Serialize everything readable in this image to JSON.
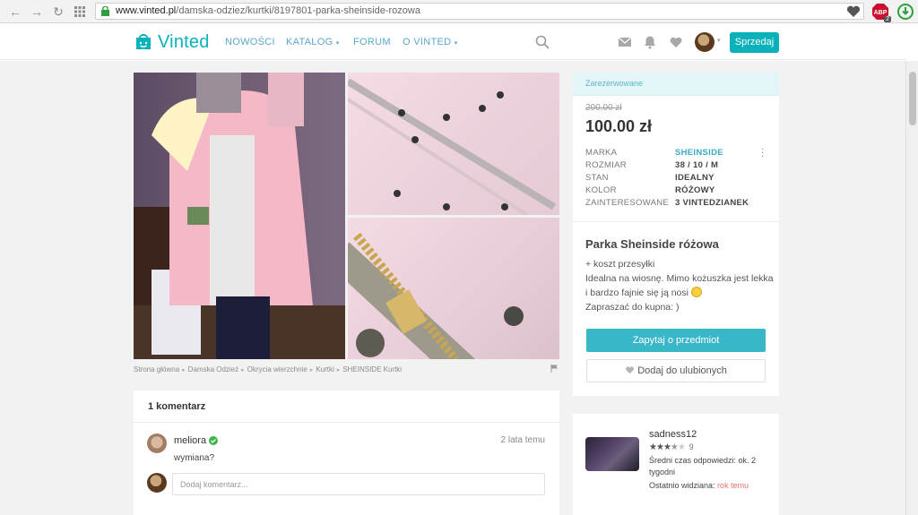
{
  "browser": {
    "url_domain": "www.vinted.pl",
    "url_path": "/damska-odziez/kurtki/8197801-parka-sheinside-rozowa",
    "abp_badge": "2"
  },
  "nav": {
    "logo": "Vinted",
    "links": [
      "NOWOŚCI",
      "KATALOG",
      "FORUM",
      "O VINTED"
    ],
    "sell_label": "Sprzedaj"
  },
  "breadcrumb": [
    "Strona główna",
    "Damska Odzież",
    "Okrycia wierzchnie",
    "Kurtki",
    "SHEINSIDE Kurtki"
  ],
  "item": {
    "status": "Zarezerwowane",
    "old_price": "200.00 zł",
    "price": "100.00 zł",
    "attributes": [
      {
        "key": "MARKA",
        "value": "SHEINSIDE"
      },
      {
        "key": "ROZMIAR",
        "value": "38 / 10 / M"
      },
      {
        "key": "STAN",
        "value": "IDEALNY"
      },
      {
        "key": "KOLOR",
        "value": "RÓŻOWY"
      },
      {
        "key": "ZAINTERESOWANE",
        "value": "3 VINTEDZIANEK"
      }
    ],
    "title": "Parka Sheinside różowa",
    "shipping": "+ koszt przesyłki",
    "description_1": "Idealna na wiosnę. Mimo kożuszka jest lekka i bardzo fajnie się ją nosi",
    "description_2": "Zapraszać do kupna: )",
    "ask_label": "Zapytaj o przedmiot",
    "fav_label": "Dodaj do ulubionych"
  },
  "comments": {
    "header": "1 komentarz",
    "items": [
      {
        "user": "meliora",
        "time": "2 lata temu",
        "text": "wymiana?"
      }
    ],
    "input_placeholder": "Dodaj komentarz..."
  },
  "seller": {
    "name": "sadness12",
    "rating": 3.5,
    "review_count": "9",
    "response_label": "Średni czas odpowiedzi: ok. 2 tygodni",
    "last_seen_label": "Ostatnio widziana:",
    "last_seen_value": "rok temu"
  },
  "colors": {
    "brand": "#09b1ba",
    "accent_button": "#3ab6c9"
  }
}
